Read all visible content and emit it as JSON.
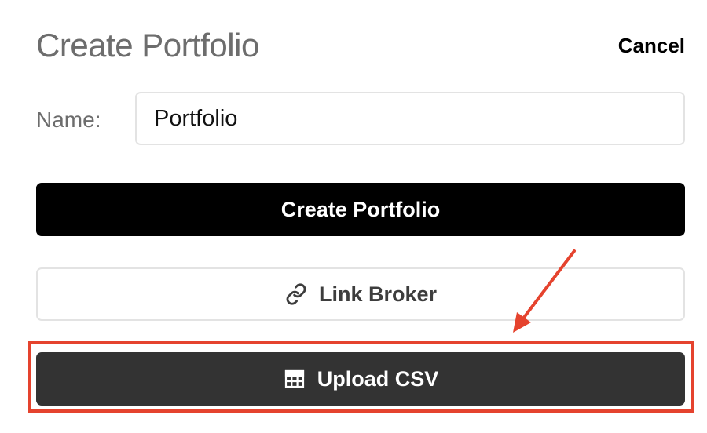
{
  "dialog": {
    "title": "Create Portfolio",
    "cancel_label": "Cancel"
  },
  "form": {
    "name_label": "Name:",
    "name_value": "Portfolio"
  },
  "actions": {
    "create_label": "Create Portfolio",
    "link_broker_label": "Link Broker",
    "link_broker_icon": "link-icon",
    "upload_csv_label": "Upload CSV",
    "upload_csv_icon": "table-icon"
  },
  "annotation": {
    "color": "#e5432e",
    "target": "upload-csv-button"
  },
  "colors": {
    "create_button_bg": "#000000",
    "upload_button_bg": "#333333",
    "title_text": "#6d6d6d"
  }
}
